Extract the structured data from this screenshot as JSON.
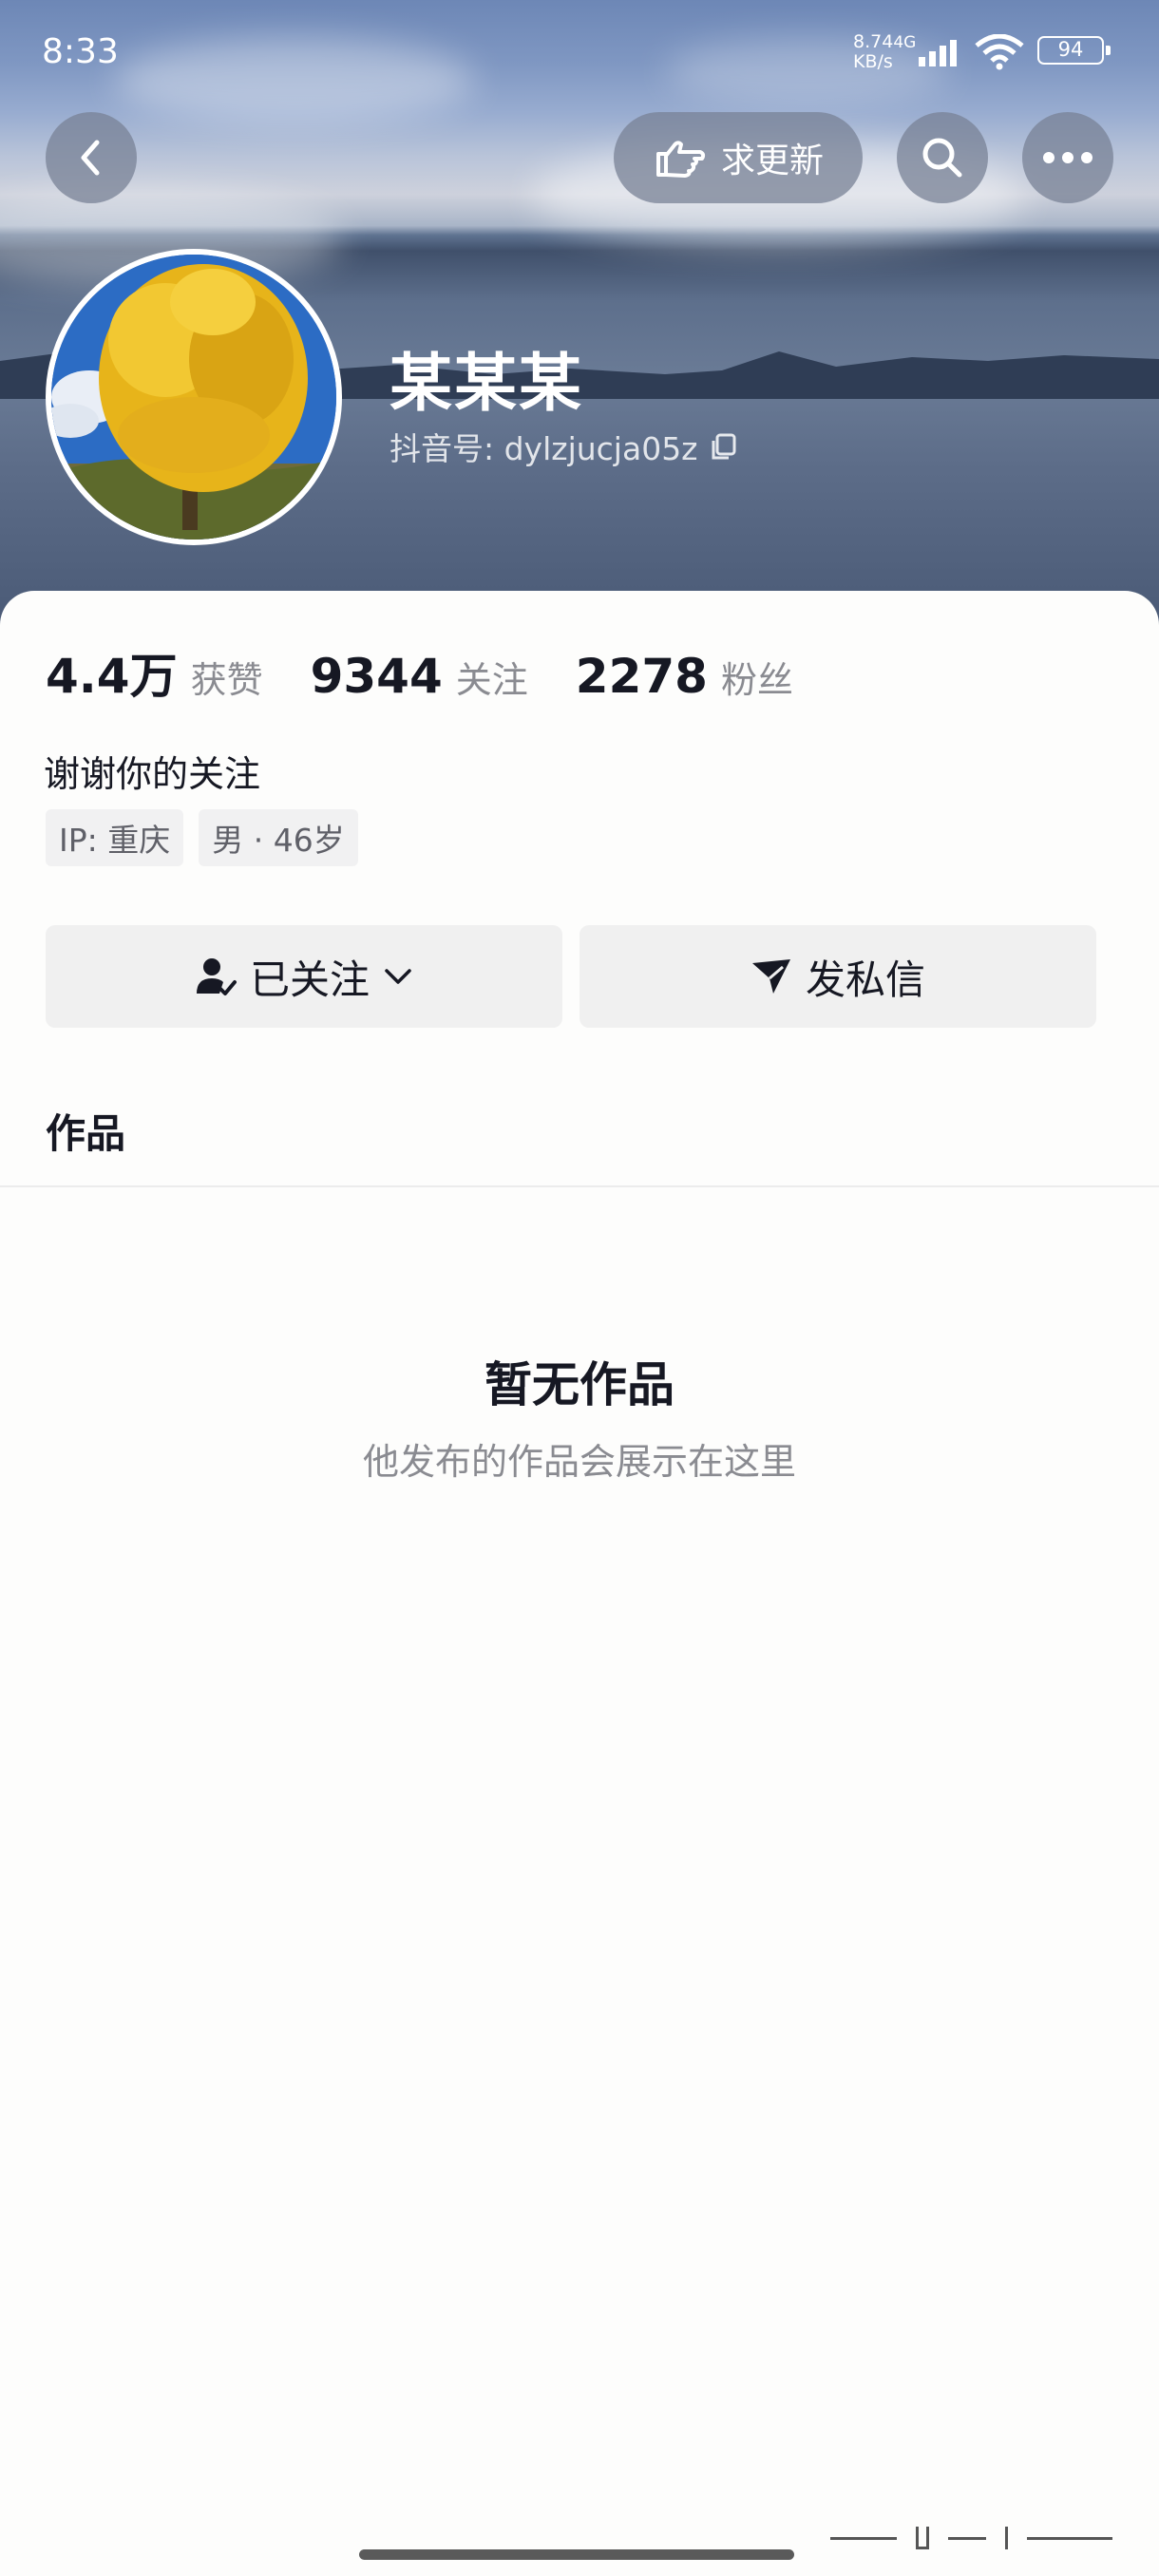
{
  "status_bar": {
    "time": "8:33",
    "net_speed": "8.74",
    "net_unit": "KB/s",
    "net_type": "4G",
    "battery": "94"
  },
  "header": {
    "request_update_label": "求更新",
    "back_icon": "chevron-left-icon",
    "search_icon": "search-icon",
    "more_icon": "more-dots-icon"
  },
  "profile": {
    "name": "某某某",
    "douyin_id": "抖音号: dylzjucja05z"
  },
  "stats": [
    {
      "value": "4.4万",
      "label": "获赞"
    },
    {
      "value": "9344",
      "label": "关注"
    },
    {
      "value": "2278",
      "label": "粉丝"
    }
  ],
  "bio": "谢谢你的关注",
  "tags": [
    "IP: 重庆",
    "男 · 46岁"
  ],
  "actions": {
    "followed_label": "已关注",
    "message_label": "发私信"
  },
  "works": {
    "section_title": "作品",
    "empty_title": "暂无作品",
    "empty_subtitle": "他发布的作品会展示在这里"
  },
  "colors": {
    "text_primary": "#161823",
    "text_secondary": "#8a8b91",
    "button_bg": "#f0f0f0",
    "overlay_btn": "#78829680"
  }
}
